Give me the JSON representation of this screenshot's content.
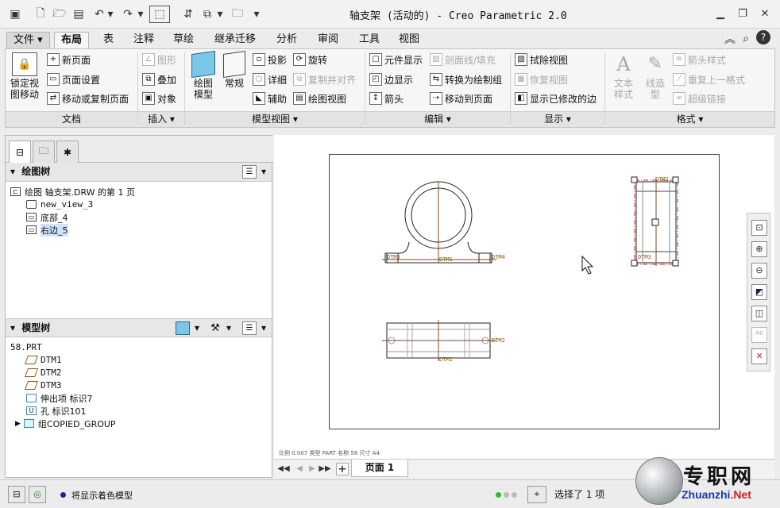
{
  "window": {
    "title": "轴支架 (活动的) - Creo Parametric 2.0",
    "controls": [
      "minimize-icon",
      "restore-icon",
      "close-icon"
    ]
  },
  "tabs": [
    {
      "label": "文件",
      "dropdown": "▾"
    },
    {
      "label": "布局"
    },
    {
      "label": "表"
    },
    {
      "label": "注释"
    },
    {
      "label": "草绘"
    },
    {
      "label": "继承迁移"
    },
    {
      "label": "分析"
    },
    {
      "label": "审阅"
    },
    {
      "label": "工具"
    },
    {
      "label": "视图"
    }
  ],
  "ribbon": {
    "document": {
      "lock_view_l1": "锁定视",
      "lock_view_l2": "图移动",
      "new_page": "新页面",
      "page_setup": "页面设置",
      "move_copy_page": "移动或复制页面",
      "group_label": "文档"
    },
    "insert": {
      "graphics": "图形",
      "overlay": "叠加",
      "object": "对象",
      "group_label": "插入 ▾"
    },
    "model_views": {
      "drawing_model_l1": "绘图",
      "drawing_model_l2": "模型",
      "general": "常规",
      "projection": "投影",
      "detailed": "详细",
      "auxiliary": "辅助",
      "rotate": "旋转",
      "copy_align": "复制并对齐",
      "drawing_view": "绘图视图",
      "group_label": "模型视图 ▾"
    },
    "edit": {
      "component_display": "元件显示",
      "section_fill": "剖面线/填充",
      "edge_display": "边显示",
      "convert_draft_group": "转换为绘制组",
      "arrow": "箭头",
      "move_to_page": "移动到页面",
      "group_label": "编辑 ▾"
    },
    "display": {
      "erase_view": "拭除视图",
      "restore_view": "恢复视图",
      "show_modified_edges": "显示已修改的边",
      "group_label": "显示 ▾"
    },
    "format": {
      "text_style_l1": "文本",
      "text_style_l2": "样式",
      "line_style_l1": "线造",
      "line_style_l2": "型",
      "arrow_style": "箭头样式",
      "repeat_last_format": "重复上一格式",
      "hyperlink": "超级链接",
      "group_label": "格式 ▾"
    }
  },
  "drawing_tree": {
    "title": "绘图树",
    "root": "绘图 轴支架.DRW 的第 1 页",
    "items": [
      "new_view_3",
      "底部_4",
      "右边_5"
    ],
    "selected": "右边_5"
  },
  "model_tree": {
    "title": "模型树",
    "root": "58.PRT",
    "items": [
      "DTM1",
      "DTM2",
      "DTM3",
      "伸出项 标识7",
      "孔 标识101",
      "组COPIED_GROUP"
    ]
  },
  "drawing": {
    "labels": {
      "dtm1": "DTM1",
      "dtm2": "DTM2",
      "dtm3": "DTM3",
      "dtm4": "DTM4"
    },
    "bottom_labels": "比例 0.007    类型 PART    名称 58    尺寸 A4"
  },
  "page_bar": {
    "page_tab": "页面 1",
    "add": "+"
  },
  "status_bar": {
    "message": "将显示着色模型",
    "selection": "选择了 1 项"
  },
  "watermark": {
    "big": "专职网",
    "small": "Zhuanzhi.Net"
  },
  "colors": {
    "model_line": "#7a4a2a",
    "datum_text": "#8a5a10",
    "selection": "#cc2222",
    "highlight": "#cfe3ff",
    "status_ok": "#33bb33"
  }
}
